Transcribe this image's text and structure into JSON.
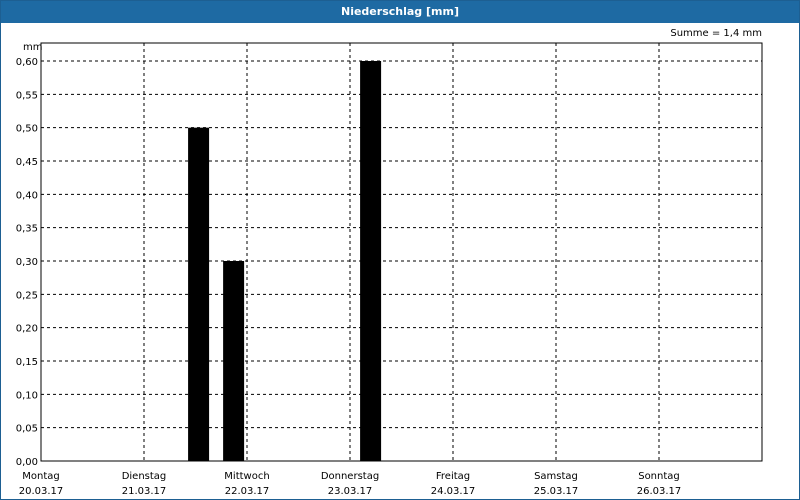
{
  "window": {
    "title": "Niederschlag [mm]"
  },
  "chart_data": {
    "type": "bar",
    "title": "Niederschlag [mm]",
    "ylabel": "mm",
    "sum_label": "Summe = 1,4 mm",
    "ylim": [
      0,
      0.6
    ],
    "yticks": [
      "0,00",
      "0,05",
      "0,10",
      "0,15",
      "0,20",
      "0,25",
      "0,30",
      "0,35",
      "0,40",
      "0,45",
      "0,50",
      "0,55",
      "0,60"
    ],
    "days": [
      {
        "name": "Montag",
        "date": "20.03.17"
      },
      {
        "name": "Dienstag",
        "date": "21.03.17"
      },
      {
        "name": "Mittwoch",
        "date": "22.03.17"
      },
      {
        "name": "Donnerstag",
        "date": "23.03.17"
      },
      {
        "name": "Freitag",
        "date": "24.03.17"
      },
      {
        "name": "Samstag",
        "date": "25.03.17"
      },
      {
        "name": "Sonntag",
        "date": "26.03.17"
      }
    ],
    "bars": [
      {
        "day": 1.53,
        "value": 0.5
      },
      {
        "day": 1.87,
        "value": 0.3
      },
      {
        "day": 3.2,
        "value": 0.6
      }
    ],
    "bar_color": "#000000",
    "grid": true
  }
}
